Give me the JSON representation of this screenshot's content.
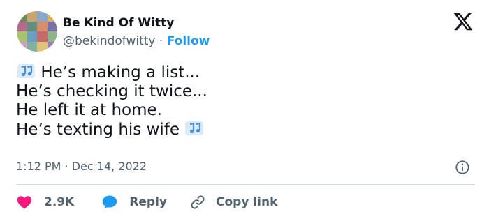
{
  "author": {
    "name": "Be Kind Of Witty",
    "handle": "@bekindofwitty",
    "separator": " · ",
    "follow_label": "Follow"
  },
  "tweet": {
    "lines": [
      "He’s making a list...",
      "He’s checking it twice...",
      "He left it at home.",
      "He’s texting his wife"
    ],
    "timestamp": "1:12 PM · Dec 14, 2022"
  },
  "actions": {
    "likes_count": "2.9K",
    "reply_label": "Reply",
    "copy_label": "Copy link"
  },
  "icons": {
    "brand": "x-logo-icon",
    "music": "musical-notes-icon",
    "info": "info-icon",
    "like": "heart-icon",
    "reply": "speech-bubble-icon",
    "copy": "link-icon"
  },
  "colors": {
    "accent": "#1d9bf0",
    "like": "#f91880",
    "text": "#0f1419",
    "secondary": "#536471",
    "divider": "#cfd9de"
  }
}
